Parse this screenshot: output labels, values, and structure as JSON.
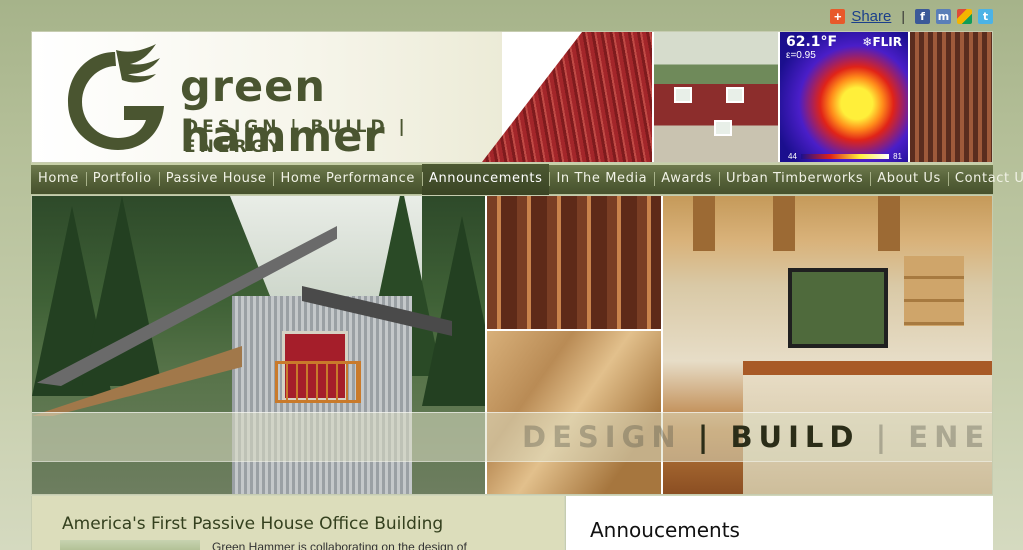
{
  "share": {
    "label": "Share",
    "separator": "|",
    "icons": [
      "share-plus-icon",
      "facebook-icon",
      "myspace-icon",
      "google-icon",
      "twitter-icon"
    ]
  },
  "header": {
    "brand": "green hammer",
    "tagline": "DESIGN | BUILD | ENERGY",
    "thermal_temp": "62.1°F",
    "thermal_emissivity": "ε=0.95",
    "thermal_brand": "❄FLIR",
    "thermal_scale_min": "44",
    "thermal_scale_max": "81"
  },
  "nav": {
    "items": [
      {
        "label": "Home"
      },
      {
        "label": "Portfolio"
      },
      {
        "label": "Passive House"
      },
      {
        "label": "Home Performance"
      },
      {
        "label": "Announcements"
      },
      {
        "label": "In The Media"
      },
      {
        "label": "Awards"
      },
      {
        "label": "Urban Timberworks"
      },
      {
        "label": "About Us"
      },
      {
        "label": "Contact Us"
      }
    ],
    "active_index": 4
  },
  "hero": {
    "slogan_design": "DESIGN",
    "slogan_bar1": "|",
    "slogan_build": "BUILD",
    "slogan_bar2": "|",
    "slogan_energy": "ENERGY"
  },
  "main": {
    "story_title": "America's First Passive House Office Building",
    "story_text": "Green Hammer is collaborating on the design of"
  },
  "sidebar": {
    "title": "Annoucements"
  },
  "colors": {
    "brand_green": "#4a5530",
    "nav_bg": "#566239",
    "page_bg": "#b4bf98"
  }
}
